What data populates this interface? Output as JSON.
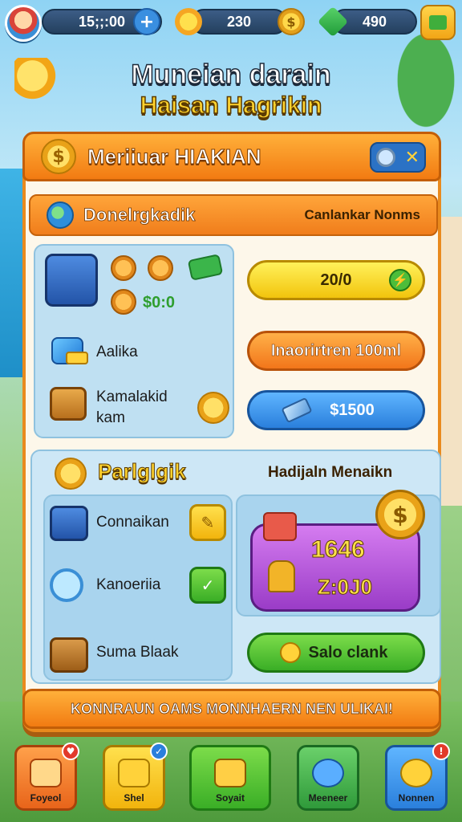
{
  "hud": {
    "timer": "15;;:00",
    "plus_icon": "+",
    "coins": "230",
    "gems": "490",
    "icons": [
      "avatar",
      "plus-icon",
      "sun-icon",
      "coin-icon",
      "gem-icon",
      "shop-icon"
    ]
  },
  "title": {
    "line1": "Muneian darain",
    "line2": "Haisan Hagrikin"
  },
  "panel": {
    "header_title": "Meriiuar HIAKIAN",
    "close_icon": "✕",
    "sub_header_left": "Donelrgkadik",
    "sub_header_right": "Canlankar Nonms"
  },
  "shop": {
    "bonus_amount": "$0:0",
    "item1_label": "Aalika",
    "item2_label_line1": "Kamalakid",
    "item2_label_line2": "kam",
    "btn_yellow": "20/0",
    "btn_yellow_icon": "⚡",
    "btn_orange": "Inaorirtren 100ml",
    "btn_blue": "$1500"
  },
  "rewards": {
    "title": "Parlglgik",
    "right_title": "Hadijaln Menaikn",
    "items": [
      {
        "label": "Connaikan"
      },
      {
        "label": "Kanoeriia"
      },
      {
        "label": "Suma Blaak"
      }
    ],
    "reward_value1": "1646",
    "reward_value2": "Z:0J0",
    "collect_button": "Salo clank"
  },
  "footer_banner": "KONNRAUN OAMS MONNHAERN NEN ULIKAI!",
  "nav": [
    {
      "label": "Foyeol",
      "badge": "♥"
    },
    {
      "label": "Shel",
      "badge": "✓"
    },
    {
      "label": "Soyait"
    },
    {
      "label": "Meeneer"
    },
    {
      "label": "Nonnen",
      "badge": "!"
    }
  ],
  "colors": {
    "panel_orange": "#f27b12",
    "button_yellow": "#f2c40d",
    "button_blue": "#2a7fdc",
    "button_green": "#3aae26",
    "reward_purple": "#9a3cc7"
  }
}
